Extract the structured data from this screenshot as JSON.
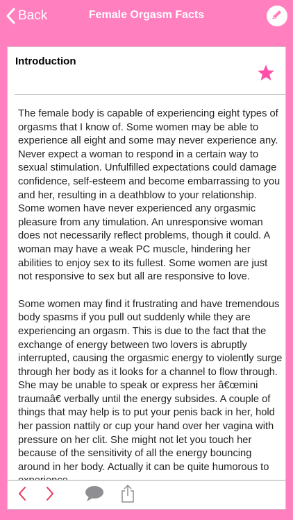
{
  "navbar": {
    "back_label": "Back",
    "title": "Female Orgasm Facts",
    "back_icon": "chevron-left-icon",
    "edit_icon": "pencil-icon"
  },
  "article": {
    "section_title": "Introduction",
    "favorite_icon": "star-icon",
    "paragraphs": [
      "The female body is capable of experiencing eight types of orgasms that I know of. Some women may be able to experience all eight and some may never experience any. Never expect a woman to respond in a certain way to sexual stimulation. Unfulfilled expectations could damage confidence, self-esteem and become embarrassing to you and her, resulting in a deathblow to your relationship. Some women have never experienced any orgasmic pleasure from any timulation. An unresponsive woman does not necessarily reflect problems, though it could. A woman may have a weak PC muscle, hindering her abilities to enjoy sex to its fullest. Some women are just not responsive to sex but all are responsive to love.",
      "Some women may find it frustrating and have tremendous body spasms if you pull out suddenly while they are experiencing an orgasm. This is due to the fact that the exchange of energy between two lovers is abruptly interrupted, causing the orgasmic energy to violently surge through her body as it looks for a channel to flow through. She may be unable to speak or express her â€œmini traumaâ€ verbally until the energy subsides. A couple of things that may help is to put your penis back in her, hold her passion nattily or cup your hand over her vagina with pressure on her clit. She might not let you touch her because of the sensitivity of all the energy bouncing around in her body. Actually it can be quite humorous to experience"
    ]
  },
  "toolbar": {
    "prev_icon": "chevron-left-icon",
    "next_icon": "chevron-right-icon",
    "comment_icon": "speech-bubble-icon",
    "share_icon": "share-icon"
  },
  "colors": {
    "brand_pink": "#ff7fbf",
    "icon_red": "#e8365a",
    "icon_gray": "#8e8e93"
  }
}
